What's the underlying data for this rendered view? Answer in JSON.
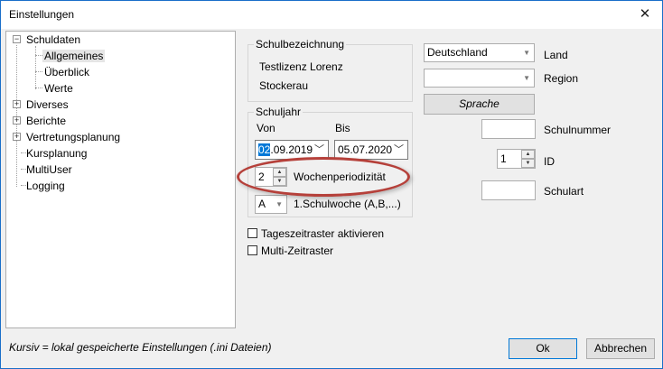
{
  "window": {
    "title": "Einstellungen",
    "close_icon": "close-icon"
  },
  "tree": {
    "items": [
      {
        "label": "Schuldaten",
        "expander": "−"
      },
      {
        "label": "Allgemeines"
      },
      {
        "label": "Überblick"
      },
      {
        "label": "Werte"
      },
      {
        "label": "Diverses",
        "expander": "+"
      },
      {
        "label": "Berichte",
        "expander": "+"
      },
      {
        "label": "Vertretungsplanung",
        "expander": "+"
      },
      {
        "label": "Kursplanung"
      },
      {
        "label": "MultiUser"
      },
      {
        "label": "Logging"
      }
    ]
  },
  "schulbezeichnung": {
    "legend": "Schulbezeichnung",
    "line1": "Testlizenz Lorenz",
    "line2": "Stockerau"
  },
  "schuljahr": {
    "legend": "Schuljahr",
    "von_label": "Von",
    "bis_label": "Bis",
    "von_day": "02",
    "von_rest": ".09.2019",
    "bis_value": "05.07.2020",
    "perioden_value": "2",
    "perioden_label": "Wochenperiodizität",
    "woche_value": "A",
    "woche_label": "1.Schulwoche (A,B,...)"
  },
  "options": {
    "tageszeitraster": "Tageszeitraster aktivieren",
    "multizeitraster": "Multi-Zeitraster"
  },
  "right": {
    "land_value": "Deutschland",
    "land_label": "Land",
    "region_value": "",
    "region_label": "Region",
    "sprache_button": "Sprache",
    "schulnummer_label": "Schulnummer",
    "schulnummer_value": "",
    "id_value": "1",
    "id_label": "ID",
    "schulart_label": "Schulart",
    "schulart_value": ""
  },
  "footer": {
    "note": "Kursiv = lokal gespeicherte Einstellungen (.ini Dateien)",
    "ok": "Ok",
    "cancel": "Abbrechen"
  },
  "colors": {
    "highlight_ring": "#b5403a",
    "selection": "#0078d7",
    "window_border": "#1a6fc9"
  }
}
